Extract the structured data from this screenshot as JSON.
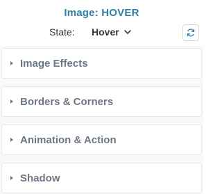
{
  "header": {
    "title": "Image: HOVER",
    "state_label": "State:",
    "state_value": "Hover",
    "state_dropdown_icon": "chevron-down-icon",
    "reset_icon": "refresh-icon"
  },
  "sections": [
    {
      "label": "Image Effects",
      "icon": "caret-right-icon"
    },
    {
      "label": "Borders & Corners",
      "icon": "caret-right-icon"
    },
    {
      "label": "Animation & Action",
      "icon": "caret-right-icon"
    },
    {
      "label": "Shadow",
      "icon": "caret-right-icon"
    }
  ],
  "colors": {
    "title": "#2d7fa6",
    "section_text": "#6d7784",
    "panel_bg": "#f8f9fa",
    "border": "#e4e7eb"
  }
}
